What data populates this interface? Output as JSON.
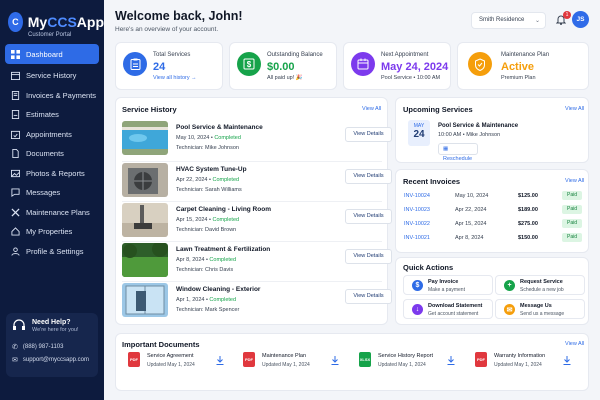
{
  "app": {
    "name_a": "My",
    "name_b": "CCS",
    "name_c": "App",
    "subtitle": "Customer Portal",
    "logo_letter": "C"
  },
  "sidebar": {
    "items": [
      {
        "label": "Dashboard",
        "icon": "grid-icon",
        "active": true
      },
      {
        "label": "Service History",
        "icon": "calendar-icon"
      },
      {
        "label": "Invoices & Payments",
        "icon": "invoice-icon"
      },
      {
        "label": "Estimates",
        "icon": "estimate-icon"
      },
      {
        "label": "Appointments",
        "icon": "calendar-check-icon"
      },
      {
        "label": "Documents",
        "icon": "document-icon"
      },
      {
        "label": "Photos & Reports",
        "icon": "image-icon"
      },
      {
        "label": "Messages",
        "icon": "chat-icon"
      },
      {
        "label": "Maintenance Plans",
        "icon": "tools-icon"
      },
      {
        "label": "My Properties",
        "icon": "home-icon"
      },
      {
        "label": "Profile & Settings",
        "icon": "user-icon"
      }
    ],
    "help": {
      "title": "Need Help?",
      "subtitle": "We're here for you!",
      "phone": "(888) 987-1103",
      "email": "support@myccsapp.com"
    }
  },
  "header": {
    "title": "Welcome back, John!",
    "subtitle": "Here's an overview of your account.",
    "property": "Smith Residence",
    "notifications": "1",
    "avatar": "JS"
  },
  "stats": [
    {
      "label": "Total Services",
      "value": "24",
      "sub": "View all history →",
      "color": "#2e6be6",
      "bg": "#e4edfd",
      "icon": "clipboard-icon"
    },
    {
      "label": "Outstanding Balance",
      "value": "$0.00",
      "sub": "All paid up! 🎉",
      "color": "#16a34a",
      "bg": "#e3f6ea",
      "icon": "dollar-icon"
    },
    {
      "label": "Next Appointment",
      "value": "May 24, 2024",
      "sub": "Pool Service • 10:00 AM",
      "color": "#7c3aed",
      "bg": "#efe7fd",
      "icon": "calendar-icon"
    },
    {
      "label": "Maintenance Plan",
      "value": "Active",
      "sub": "Premium Plan",
      "color": "#f59e0b",
      "bg": "#fef2dc",
      "icon": "shield-icon"
    }
  ],
  "service_history": {
    "title": "Service History",
    "view_all": "View All",
    "button": "View Details",
    "items": [
      {
        "title": "Pool Service & Maintenance",
        "date": "May 10, 2024",
        "status": "Completed",
        "tech": "Technician: Mike Johnson"
      },
      {
        "title": "HVAC System Tune-Up",
        "date": "Apr 22, 2024",
        "status": "Completed",
        "tech": "Technician: Sarah Williams"
      },
      {
        "title": "Carpet Cleaning - Living Room",
        "date": "Apr 15, 2024",
        "status": "Completed",
        "tech": "Technician: David Brown"
      },
      {
        "title": "Lawn Treatment & Fertilization",
        "date": "Apr 8, 2024",
        "status": "Completed",
        "tech": "Technician: Chris Davis"
      },
      {
        "title": "Window Cleaning - Exterior",
        "date": "Apr 1, 2024",
        "status": "Completed",
        "tech": "Technician: Mark Spencer"
      }
    ]
  },
  "upcoming": {
    "title": "Upcoming Services",
    "view_all": "View All",
    "month": "MAY",
    "day": "24",
    "service": "Pool Service & Maintenance",
    "detail": "10:00 AM  •  Mike Johnson",
    "reschedule": "Reschedule"
  },
  "invoices": {
    "title": "Recent Invoices",
    "view_all": "View All",
    "rows": [
      {
        "id": "INV-10024",
        "date": "May 10, 2024",
        "amount": "$125.00",
        "status": "Paid"
      },
      {
        "id": "INV-10023",
        "date": "Apr 22, 2024",
        "amount": "$189.00",
        "status": "Paid"
      },
      {
        "id": "INV-10022",
        "date": "Apr 15, 2024",
        "amount": "$275.00",
        "status": "Paid"
      },
      {
        "id": "INV-10021",
        "date": "Apr 8, 2024",
        "amount": "$150.00",
        "status": "Paid"
      }
    ]
  },
  "quick_actions": {
    "title": "Quick Actions",
    "items": [
      {
        "title": "Pay Invoice",
        "sub": "Make a payment",
        "color": "#2e6be6",
        "glyph": "$"
      },
      {
        "title": "Request Service",
        "sub": "Schedule a new job",
        "color": "#16a34a",
        "glyph": "+"
      },
      {
        "title": "Download Statement",
        "sub": "Get account statement",
        "color": "#7c3aed",
        "glyph": "↓"
      },
      {
        "title": "Message Us",
        "sub": "Send us a message",
        "color": "#f59e0b",
        "glyph": "✉"
      }
    ]
  },
  "documents": {
    "title": "Important Documents",
    "view_all": "View All",
    "items": [
      {
        "title": "Service Agreement",
        "sub": "Updated May 1, 2024",
        "type": "PDF",
        "color": "#e0383e"
      },
      {
        "title": "Maintenance Plan",
        "sub": "Updated May 1, 2024",
        "type": "PDF",
        "color": "#e0383e"
      },
      {
        "title": "Service History Report",
        "sub": "Updated May 1, 2024",
        "type": "XLSX",
        "color": "#16a34a"
      },
      {
        "title": "Warranty Information",
        "sub": "Updated May 1, 2024",
        "type": "PDF",
        "color": "#e0383e"
      }
    ]
  }
}
